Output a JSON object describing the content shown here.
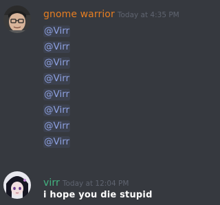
{
  "messages": [
    {
      "username": "gnome warrior",
      "username_color": "#e67e22",
      "timestamp": "Today at 4:35 PM",
      "avatar_icon": "user-avatar-icon",
      "lines": [
        "@Virr",
        "@Virr",
        "@Virr",
        "@Virr",
        "@Virr",
        "@Virr",
        "@Virr",
        "@Virr"
      ]
    },
    {
      "username": "virr",
      "username_color": "#43b581",
      "timestamp": "Today at 12:04 PM",
      "avatar_icon": "anime-avatar-icon",
      "text": "i hope you die stupid"
    }
  ]
}
